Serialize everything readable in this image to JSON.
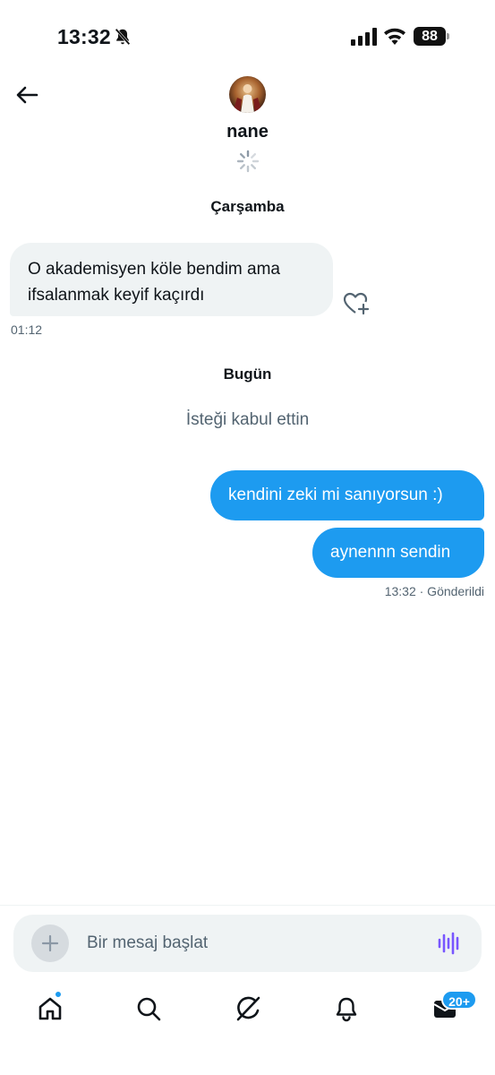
{
  "status_bar": {
    "time": "13:32",
    "battery": "88"
  },
  "header": {
    "contact_name": "nane"
  },
  "conversation": {
    "day_1": "Çarşamba",
    "incoming_message": "O akademisyen köle bendim ama ifsalanmak keyif kaçırdı",
    "incoming_time": "01:12",
    "day_2": "Bugün",
    "system_message": "İsteği kabul ettin",
    "outgoing_messages": [
      "kendini zeki mi sanıyorsun :)",
      "aynennn sendin"
    ],
    "outgoing_status": "13:32 · Gönderildi"
  },
  "composer": {
    "placeholder": "Bir mesaj başlat"
  },
  "nav": {
    "messages_badge": "20+",
    "items": [
      "home-icon",
      "search-icon",
      "grok-icon",
      "notifications-icon",
      "messages-icon"
    ]
  },
  "colors": {
    "accent": "#1d9bf0",
    "bubble_incoming": "#eff3f4",
    "secondary_text": "#536471",
    "voice_accent": "#7856ff"
  }
}
